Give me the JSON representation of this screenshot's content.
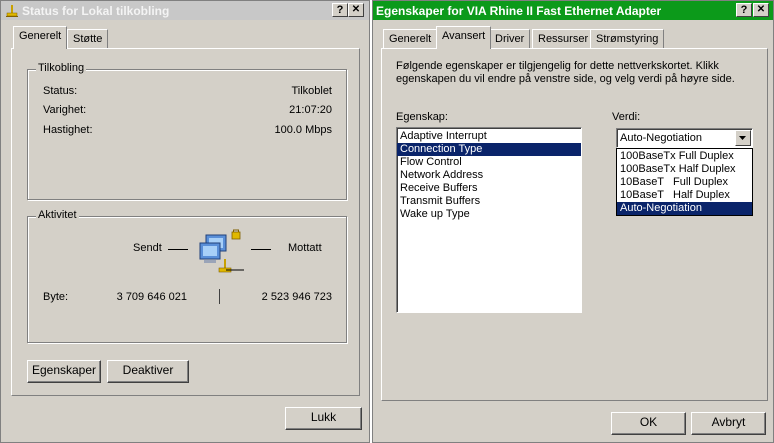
{
  "status_window": {
    "title": "Status for Lokal tilkobling",
    "help_label": "?",
    "close_label": "✕",
    "tabs": [
      "Generelt",
      "Støtte"
    ],
    "connection": {
      "legend": "Tilkobling",
      "status_label": "Status:",
      "status_value": "Tilkoblet",
      "duration_label": "Varighet:",
      "duration_value": "21:07:20",
      "speed_label": "Hastighet:",
      "speed_value": "100.0 Mbps"
    },
    "activity": {
      "legend": "Aktivitet",
      "sent_label": "Sendt",
      "received_label": "Mottatt",
      "bytes_label": "Byte:",
      "sent_bytes": "3 709 646 021",
      "received_bytes": "2 523 946 723"
    },
    "properties_button": "Egenskaper",
    "disable_button": "Deaktiver",
    "close_button": "Lukk"
  },
  "properties_window": {
    "title": "Egenskaper for VIA Rhine II Fast Ethernet Adapter",
    "help_label": "?",
    "close_label": "✕",
    "tabs": [
      "Generelt",
      "Avansert",
      "Driver",
      "Ressurser",
      "Strømstyring"
    ],
    "description": "Følgende egenskaper er tilgjengelig for dette nettverkskortet. Klikk egenskapen du vil endre på venstre side, og velg verdi på høyre side.",
    "property_label": "Egenskap:",
    "value_label": "Verdi:",
    "properties": [
      "Adaptive Interrupt",
      "Connection Type",
      "Flow Control",
      "Network Address",
      "Receive Buffers",
      "Transmit Buffers",
      "Wake up Type"
    ],
    "selected_property_index": 1,
    "value_selected": "Auto-Negotiation",
    "value_options": [
      "100BaseTx Full Duplex",
      "100BaseTx Half Duplex",
      "10BaseT   Full Duplex",
      "10BaseT   Half Duplex",
      "Auto-Negotiation"
    ],
    "highlighted_option_index": 4,
    "ok_button": "OK",
    "cancel_button": "Avbryt"
  },
  "colors": {
    "face": "#d4d0c8",
    "inactive_title": "#c8c8c8",
    "active_title": "#0c9a1a",
    "selection": "#0a246a"
  }
}
